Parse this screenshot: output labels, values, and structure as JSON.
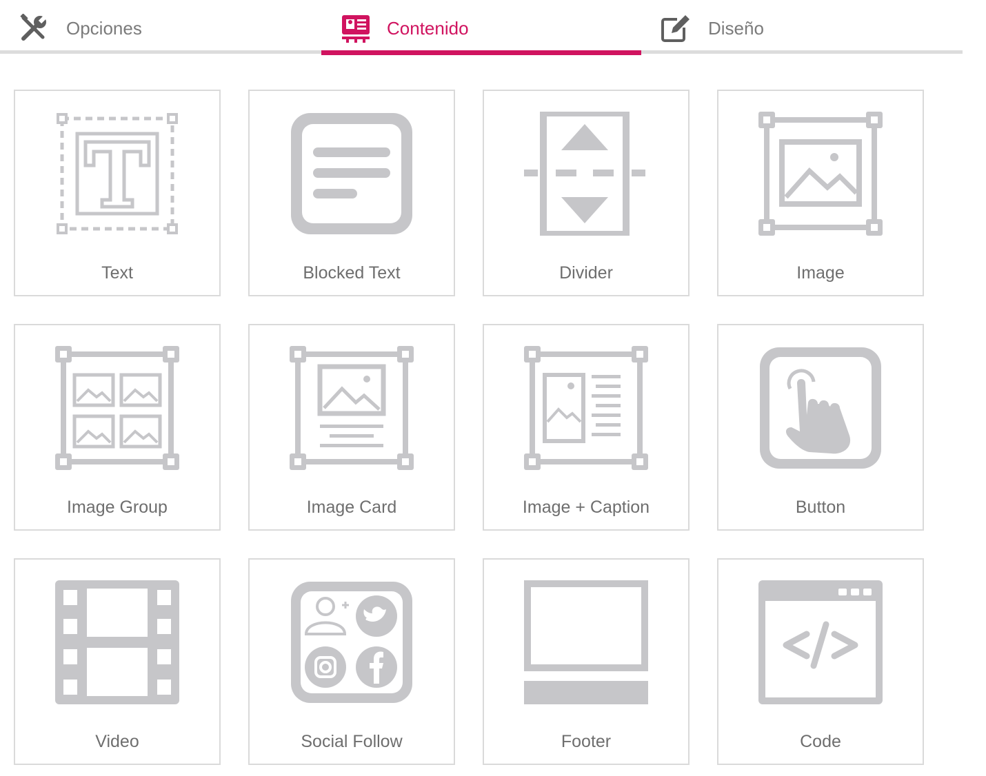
{
  "tabs": [
    {
      "label": "Opciones",
      "icon": "tools-icon",
      "active": false
    },
    {
      "label": "Contenido",
      "icon": "content-card-icon",
      "active": true
    },
    {
      "label": "Diseño",
      "icon": "edit-icon",
      "active": false
    }
  ],
  "colors": {
    "accent": "#d0135f",
    "tab_text": "#7b7b7b",
    "card_border": "#dadada",
    "card_icon": "#c6c6c9",
    "card_label": "#6e6e6e"
  },
  "blocks": [
    {
      "label": "Text",
      "icon": "text-icon"
    },
    {
      "label": "Blocked Text",
      "icon": "blocked-text-icon"
    },
    {
      "label": "Divider",
      "icon": "divider-icon"
    },
    {
      "label": "Image",
      "icon": "image-icon"
    },
    {
      "label": "Image Group",
      "icon": "image-group-icon"
    },
    {
      "label": "Image Card",
      "icon": "image-card-icon"
    },
    {
      "label": "Image + Caption",
      "icon": "image-caption-icon"
    },
    {
      "label": "Button",
      "icon": "button-icon"
    },
    {
      "label": "Video",
      "icon": "video-icon"
    },
    {
      "label": "Social Follow",
      "icon": "social-follow-icon"
    },
    {
      "label": "Footer",
      "icon": "footer-icon"
    },
    {
      "label": "Code",
      "icon": "code-icon"
    }
  ]
}
